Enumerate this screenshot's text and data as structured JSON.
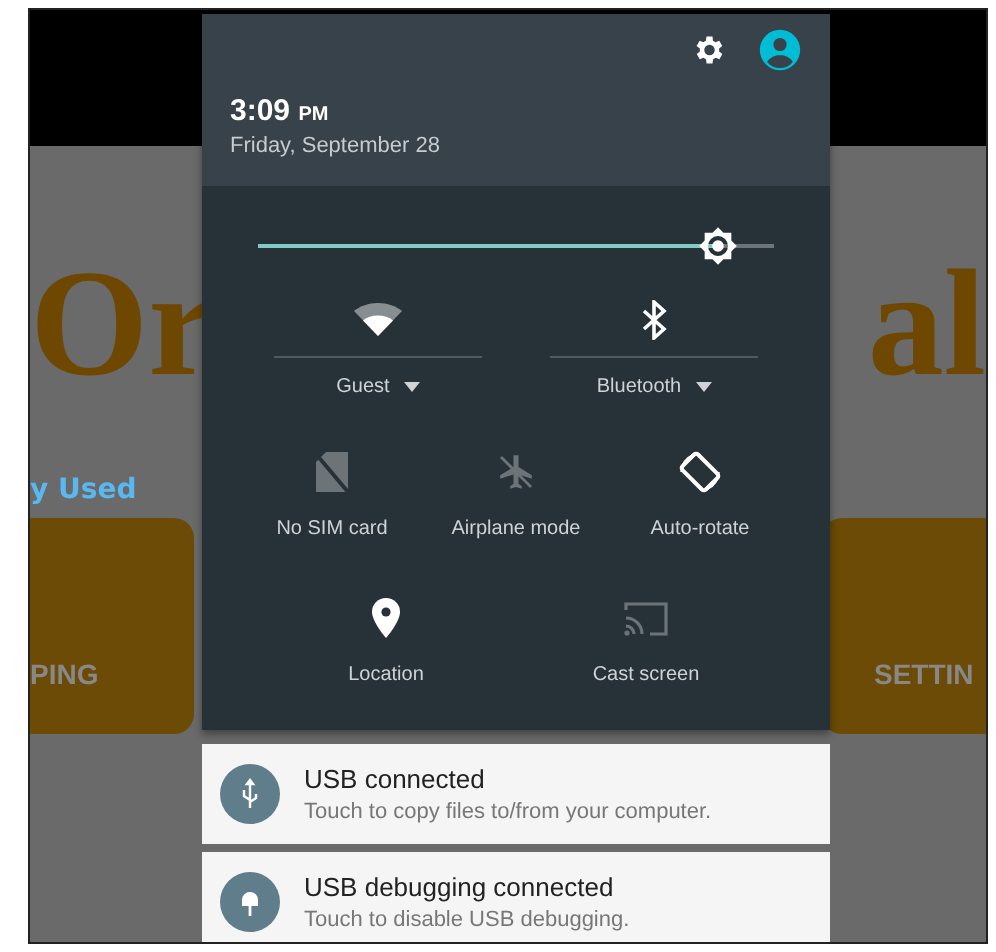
{
  "background_app": {
    "logo_left": "Or",
    "logo_right": "al",
    "section_title": "y Used",
    "tiles": [
      "PING",
      "SETTIN"
    ]
  },
  "header": {
    "time": "3:09",
    "ampm": "PM",
    "date": "Friday, September 28"
  },
  "brightness": {
    "level": 0.89
  },
  "wide_tiles": [
    {
      "kind": "wifi",
      "label": "Guest",
      "on": true
    },
    {
      "kind": "bluetooth",
      "label": "Bluetooth",
      "on": true
    }
  ],
  "tiles": [
    {
      "kind": "sim",
      "label": "No SIM card",
      "on": false
    },
    {
      "kind": "airplane",
      "label": "Airplane mode",
      "on": false
    },
    {
      "kind": "rotate",
      "label": "Auto-rotate",
      "on": true
    },
    {
      "kind": "location",
      "label": "Location",
      "on": true
    },
    {
      "kind": "cast",
      "label": "Cast screen",
      "on": false
    }
  ],
  "notifications": [
    {
      "kind": "usb",
      "title": "USB connected",
      "text": "Touch to copy files to/from your computer."
    },
    {
      "kind": "debug",
      "title": "USB debugging connected",
      "text": "Touch to disable USB debugging."
    }
  ]
}
